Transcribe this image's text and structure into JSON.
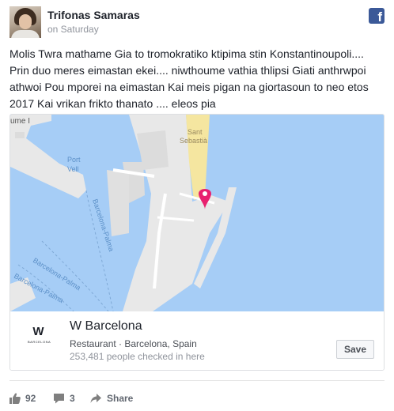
{
  "post": {
    "author": "Trifonas Samaras",
    "time": "on Saturday",
    "source_icon": "facebook-icon",
    "source_glyph": "f",
    "text": "Molis Twra mathame Gia to tromokratiko ktipima stin Konstantinoupoli.... Prin duo meres eimastan ekei.... niwthoume vathia thlipsi Giati anthrwpoi athwoi Pou mporei na eimastan Kai meis pigan na giortasoun to neo etos 2017 Kai vrikan frikto thanato .... eleos pia"
  },
  "map": {
    "labels": {
      "ume": "ume I",
      "port_vell_1": "Port",
      "port_vell_2": "Vell",
      "sant_1": "Sant",
      "sant_2": "Sebastià",
      "road_1": "Barcelona-Palma",
      "road_2": "Barcelona-Palma",
      "road_3": "Barcelona-Palma"
    },
    "colors": {
      "water": "#a6cdf6",
      "land": "#e8e8e8",
      "beach": "#f5e6a0",
      "pin": "#e8216f"
    }
  },
  "place": {
    "logo_letter": "W",
    "logo_sub": "BARCELONA",
    "name": "W Barcelona",
    "category": "Restaurant · Barcelona, Spain",
    "checkins": "253,481 people checked in here",
    "save_label": "Save"
  },
  "actions": {
    "likes": "92",
    "comments": "3",
    "share_label": "Share"
  }
}
